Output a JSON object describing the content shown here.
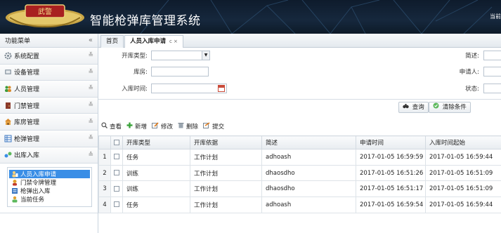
{
  "header": {
    "title": "智能枪弹库管理系统",
    "right_text": "当前",
    "logo_text": "武警"
  },
  "sidebar": {
    "title": "功能菜单",
    "collapse_glyph": "«",
    "items": [
      {
        "label": "系统配置",
        "icon": "gear-icon",
        "chev": "≚"
      },
      {
        "label": "设备管理",
        "icon": "device-icon",
        "chev": "≚"
      },
      {
        "label": "人员管理",
        "icon": "users-icon",
        "chev": "≚"
      },
      {
        "label": "门禁管理",
        "icon": "door-icon",
        "chev": "≚"
      },
      {
        "label": "库房管理",
        "icon": "house-icon",
        "chev": "≚"
      },
      {
        "label": "枪弹管理",
        "icon": "grid-icon",
        "chev": "≚"
      },
      {
        "label": "出库入库",
        "icon": "transfer-icon",
        "chev": "≙"
      }
    ],
    "sub_items": [
      {
        "label": "人员入库申请",
        "icon": "person-apply-icon",
        "active": true
      },
      {
        "label": "门禁令牌管理",
        "icon": "token-icon",
        "active": false
      },
      {
        "label": "枪弹出入库",
        "icon": "doc-icon",
        "active": false
      },
      {
        "label": "当前任务",
        "icon": "task-icon",
        "active": false
      }
    ]
  },
  "tabs": [
    {
      "label": "首页"
    },
    {
      "label": "人员入库申请",
      "close": "c ×"
    }
  ],
  "form": {
    "open_type_label": "开库类型:",
    "open_type_value": "",
    "storeroom_label": "库房:",
    "storeroom_value": "",
    "entry_time_label": "入库时间:",
    "entry_time_value": "",
    "desc_label": "简述:",
    "applicant_label": "申请人:",
    "status_label": "状态:",
    "query_button": "查询",
    "clear_button": "清除条件"
  },
  "toolbar": {
    "view": "查看",
    "add": "新增",
    "edit": "修改",
    "delete": "删除",
    "submit": "提交"
  },
  "table": {
    "columns": [
      "",
      "开库类型",
      "开库依据",
      "简述",
      "申请时间",
      "入库时间起始"
    ],
    "rows": [
      {
        "n": "1",
        "type": "任务",
        "basis": "工作计划",
        "desc": "adhoash",
        "apply_time": "2017-01-05 16:59:59",
        "start_time": "2017-01-05 16:59:44"
      },
      {
        "n": "2",
        "type": "训练",
        "basis": "工作计划",
        "desc": "dhaosdho",
        "apply_time": "2017-01-05 16:51:26",
        "start_time": "2017-01-05 16:51:09"
      },
      {
        "n": "3",
        "type": "训练",
        "basis": "工作计划",
        "desc": "dhaosdho",
        "apply_time": "2017-01-05 16:51:17",
        "start_time": "2017-01-05 16:51:09"
      },
      {
        "n": "4",
        "type": "任务",
        "basis": "工作计划",
        "desc": "adhoash",
        "apply_time": "2017-01-05 16:59:54",
        "start_time": "2017-01-05 16:59:44"
      }
    ]
  }
}
